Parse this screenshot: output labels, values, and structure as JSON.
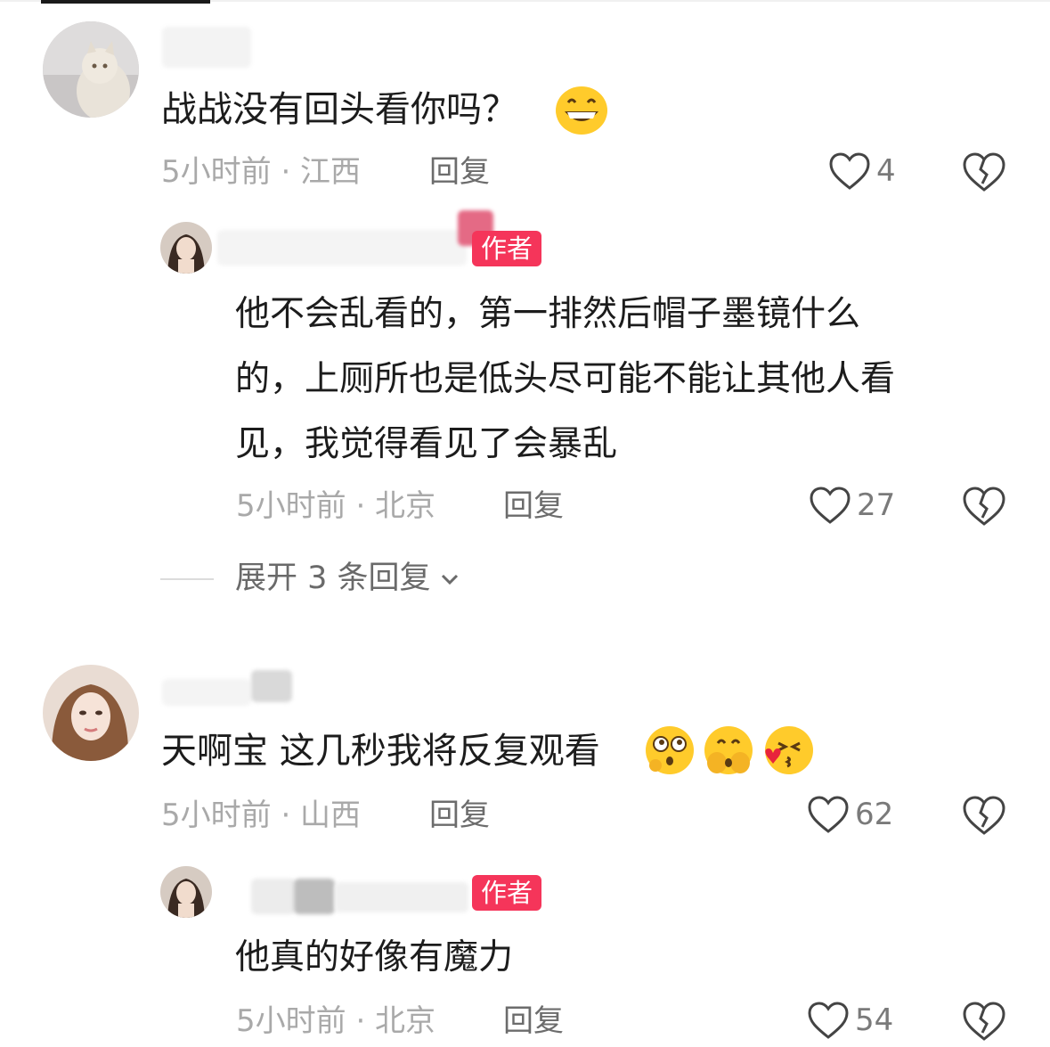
{
  "icons": {
    "like": "heart-outline-icon",
    "dislike": "broken-heart-icon",
    "expand": "chevron-down-icon"
  },
  "colors": {
    "author_badge": "#f5355a",
    "meta_text": "#a9a9a9",
    "body_text": "#1c1c1c"
  },
  "comments": [
    {
      "text": "战战没有回头看你吗？",
      "emojis": [
        "grinning-face-emoji"
      ],
      "meta": "5小时前 · 江西",
      "reply_label": "回复",
      "likes": "4",
      "replies": [
        {
          "badge": "作者",
          "lines": [
            "他不会乱看的，第一排然后帽子墨镜什么",
            "的，上厕所也是低头尽可能不能让其他人看",
            "见，我觉得看见了会暴乱"
          ],
          "meta": "5小时前 · 北京",
          "reply_label": "回复",
          "likes": "27"
        }
      ],
      "expand_label": "展开 3 条回复"
    },
    {
      "text": "天啊宝 这几秒我将反复观看",
      "emojis": [
        "thinking-eyes-emoji",
        "face-covering-emoji",
        "kissing-heart-emoji"
      ],
      "meta": "5小时前 · 山西",
      "reply_label": "回复",
      "likes": "62",
      "replies": [
        {
          "badge": "作者",
          "lines": [
            "他真的好像有魔力"
          ],
          "meta": "5小时前 · 北京",
          "reply_label": "回复",
          "likes": "54"
        }
      ]
    }
  ]
}
